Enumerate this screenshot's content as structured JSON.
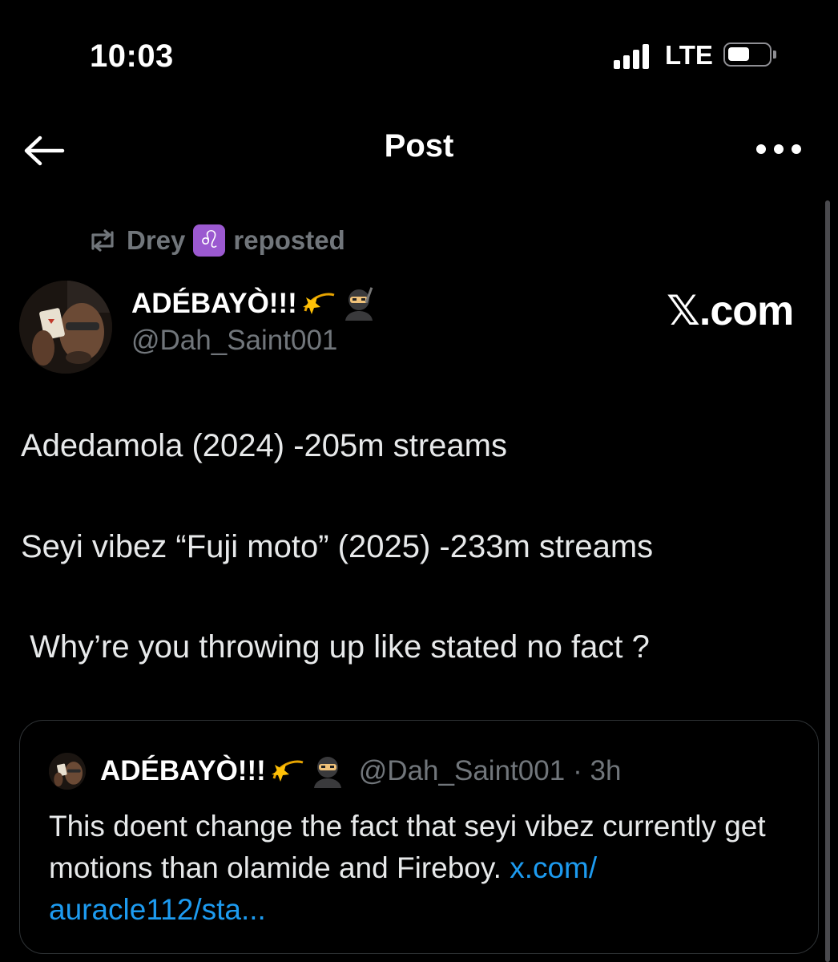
{
  "status_bar": {
    "time": "10:03",
    "network": "LTE"
  },
  "nav": {
    "title": "Post"
  },
  "repost": {
    "user": "Drey",
    "zodiac_glyph": "♌",
    "action": "reposted"
  },
  "author": {
    "name": "ADÉBAYÒ!!!",
    "handle": "@Dah_Saint001",
    "avatar_icon": "profile-photo"
  },
  "watermark": "𝕏.com",
  "post": {
    "lines": [
      "Adedamola (2024) -205m streams",
      "Seyi vibez “Fuji moto” (2025) -233m streams",
      " Why’re you throwing up like stated no fact ?"
    ]
  },
  "quoted_post": {
    "name": "ADÉBAYÒ!!!",
    "handle": "@Dah_Saint001",
    "time": "· 3h",
    "text": "This doent change the fact that seyi vibez currently get motions than olamide and Fireboy. ",
    "link_text": "x.com/ auracle112/sta..."
  },
  "colors": {
    "background": "#000000",
    "muted": "#71767b",
    "link": "#1d9bf0",
    "zodiac_bg": "#9b59d0"
  }
}
